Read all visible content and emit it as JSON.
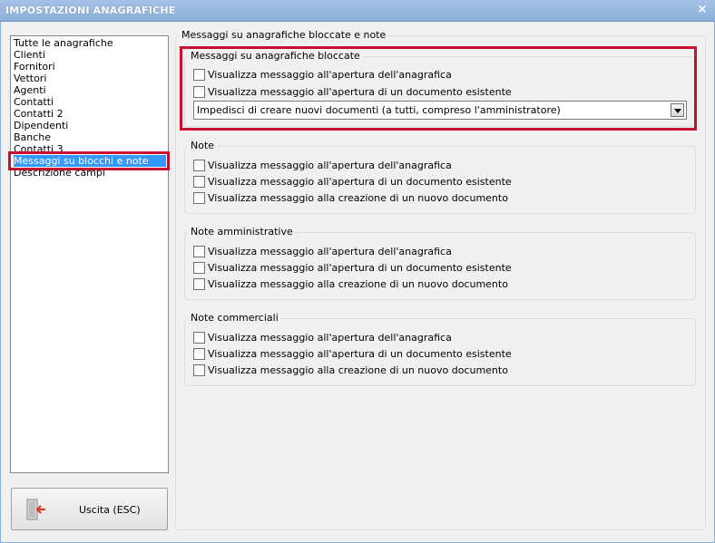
{
  "window": {
    "title": "IMPOSTAZIONI ANAGRAFICHE",
    "close_glyph": "×"
  },
  "sidebar": {
    "items": [
      {
        "label": "Tutte le anagrafiche"
      },
      {
        "label": "Clienti"
      },
      {
        "label": "Fornitori"
      },
      {
        "label": "Vettori"
      },
      {
        "label": "Agenti"
      },
      {
        "label": "Contatti"
      },
      {
        "label": "Contatti 2"
      },
      {
        "label": "Dipendenti"
      },
      {
        "label": "Banche"
      },
      {
        "label": "Contatti 3"
      },
      {
        "label": "Messaggi su blocchi e note",
        "selected": true
      },
      {
        "label": "Descrizione campi"
      }
    ],
    "selected_color": "#3399ff"
  },
  "exit_button": {
    "label": "Uscita (ESC)",
    "icon": "exit-door-icon"
  },
  "main": {
    "title": "Messaggi su anagrafiche bloccate e note",
    "blocked": {
      "title": "Messaggi su anagrafiche bloccate",
      "checkboxes": [
        {
          "label": "Visualizza messaggio all'apertura dell'anagrafica",
          "checked": false
        },
        {
          "label": "Visualizza messaggio all'apertura di un documento esistente",
          "checked": false
        }
      ],
      "select_value": "Impedisci di creare nuovi documenti (a tutti, compreso l'amministratore)"
    },
    "note": {
      "title": "Note",
      "checkboxes": [
        {
          "label": "Visualizza messaggio all'apertura dell'anagrafica",
          "checked": false
        },
        {
          "label": "Visualizza messaggio all'apertura di un documento esistente",
          "checked": false
        },
        {
          "label": "Visualizza messaggio alla creazione di un nuovo documento",
          "checked": false
        }
      ]
    },
    "note_amm": {
      "title": "Note amministrative",
      "checkboxes": [
        {
          "label": "Visualizza messaggio all'apertura dell'anagrafica",
          "checked": false
        },
        {
          "label": "Visualizza messaggio all'apertura di un documento esistente",
          "checked": false
        },
        {
          "label": "Visualizza messaggio alla creazione di un nuovo documento",
          "checked": false
        }
      ]
    },
    "note_comm": {
      "title": "Note commerciali",
      "checkboxes": [
        {
          "label": "Visualizza messaggio all'apertura dell'anagrafica",
          "checked": false
        },
        {
          "label": "Visualizza messaggio all'apertura di un documento esistente",
          "checked": false
        },
        {
          "label": "Visualizza messaggio alla creazione di un nuovo documento",
          "checked": false
        }
      ]
    }
  },
  "colors": {
    "highlight": "#c8102e",
    "titlebar": "#a5c2e6"
  }
}
